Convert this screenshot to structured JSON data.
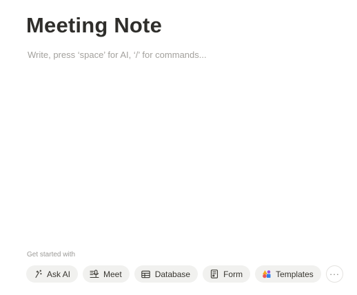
{
  "page": {
    "title": "Meeting Note",
    "placeholder": "Write, press ‘space’ for AI, ‘/’ for commands..."
  },
  "get_started": {
    "label": "Get started with",
    "chips": [
      {
        "label": "Ask AI",
        "icon": "ask-ai-icon"
      },
      {
        "label": "Meet",
        "icon": "meet-icon"
      },
      {
        "label": "Database",
        "icon": "database-icon"
      },
      {
        "label": "Form",
        "icon": "form-icon"
      },
      {
        "label": "Templates",
        "icon": "templates-icon"
      }
    ],
    "more_label": "···"
  }
}
